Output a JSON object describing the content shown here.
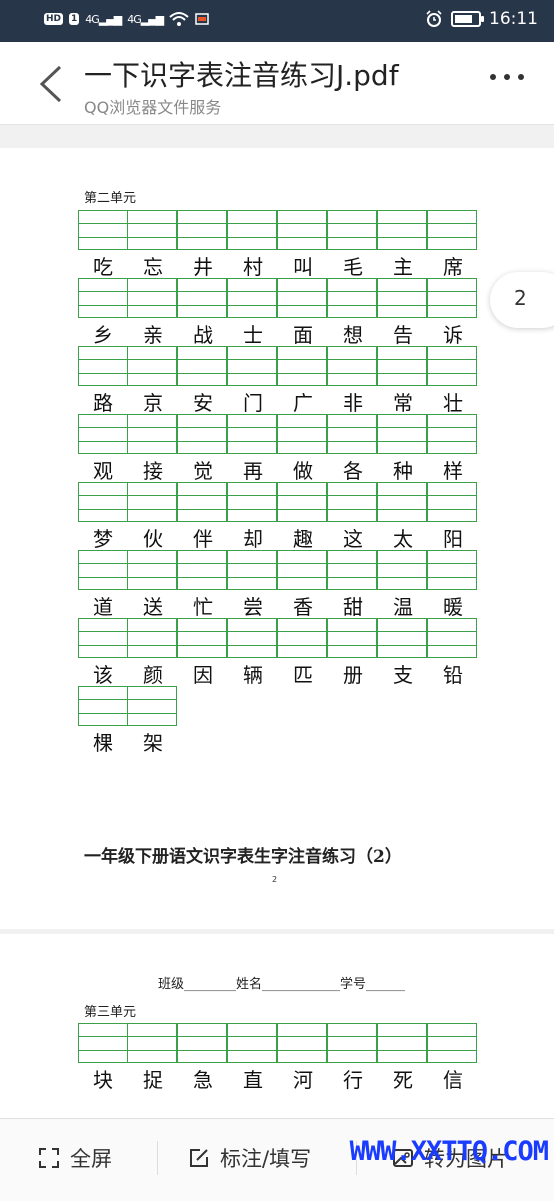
{
  "status_bar": {
    "left_badges": [
      "HD",
      "1"
    ],
    "signal_1": "4G",
    "signal_2": "4G",
    "time": "16:11"
  },
  "header": {
    "title": "一下识字表注音练习J.pdf",
    "subtitle": "QQ浏览器文件服务",
    "back_icon": "chevron-left-icon",
    "more_icon": "more-dots-icon"
  },
  "current_page": "2",
  "page1": {
    "unit_label": "第二单元",
    "rows": [
      [
        "吃",
        "忘",
        "井",
        "村",
        "叫",
        "毛",
        "主",
        "席"
      ],
      [
        "乡",
        "亲",
        "战",
        "士",
        "面",
        "想",
        "告",
        "诉"
      ],
      [
        "路",
        "京",
        "安",
        "门",
        "广",
        "非",
        "常",
        "壮"
      ],
      [
        "观",
        "接",
        "觉",
        "再",
        "做",
        "各",
        "种",
        "样"
      ],
      [
        "梦",
        "伙",
        "伴",
        "却",
        "趣",
        "这",
        "太",
        "阳"
      ],
      [
        "道",
        "送",
        "忙",
        "尝",
        "香",
        "甜",
        "温",
        "暖"
      ],
      [
        "该",
        "颜",
        "因",
        "辆",
        "匹",
        "册",
        "支",
        "铅"
      ],
      [
        "棵",
        "架"
      ]
    ],
    "footer_title": "一年级下册语文识字表生字注音练习（2）",
    "page_number": "2"
  },
  "page2": {
    "fields_line": "班级________姓名____________学号______",
    "unit_label": "第三单元",
    "rows": [
      [
        "块",
        "捉",
        "急",
        "直",
        "河",
        "行",
        "死",
        "信"
      ]
    ]
  },
  "toolbar": {
    "fullscreen_label": "全屏",
    "annotate_label": "标注/填写",
    "to_image_label": "转为图片"
  },
  "watermark": "WWW.XXTTQ.COM",
  "colors": {
    "status_bar_bg": "#28364a",
    "grid_green": "#3aa04a",
    "watermark_blue": "#1a3cff"
  }
}
